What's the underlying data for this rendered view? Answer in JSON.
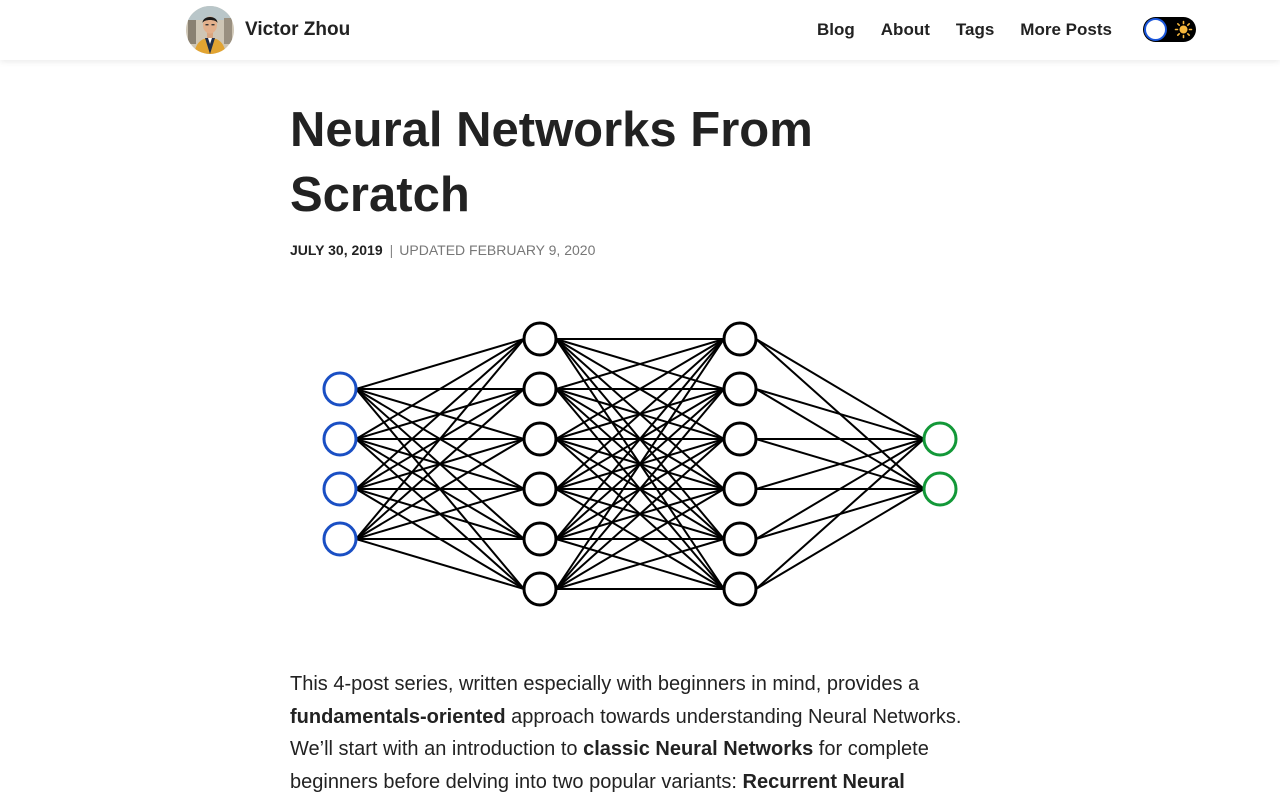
{
  "header": {
    "site_name": "Victor Zhou",
    "nav": [
      "Blog",
      "About",
      "Tags",
      "More Posts"
    ],
    "theme_toggle_icon": "sun-icon"
  },
  "article": {
    "title": "Neural Networks From Scratch",
    "date": "JULY 30, 2019",
    "separator": "|",
    "updated_label": "UPDATED",
    "updated_date": "FEBRUARY 9, 2020",
    "figure": {
      "layers": [
        {
          "nodes": 4,
          "color": "#1a4fc4"
        },
        {
          "nodes": 6,
          "color": "#000000"
        },
        {
          "nodes": 6,
          "color": "#000000"
        },
        {
          "nodes": 2,
          "color": "#139838"
        }
      ],
      "edge_color": "#000000"
    },
    "intro": {
      "text1": "This 4-post series, written especially with beginners in mind, provides a ",
      "bold1": "fundamentals-oriented",
      "text2": " approach towards understanding Neural Networks. We’ll start with an introduction to ",
      "bold2": "classic Neural Networks",
      "text3": " for complete beginners before delving into two popular variants: ",
      "bold3": "Recurrent Neural"
    }
  },
  "colors": {
    "text": "#222222",
    "muted": "#777777",
    "accent_blue": "#1a56db"
  }
}
